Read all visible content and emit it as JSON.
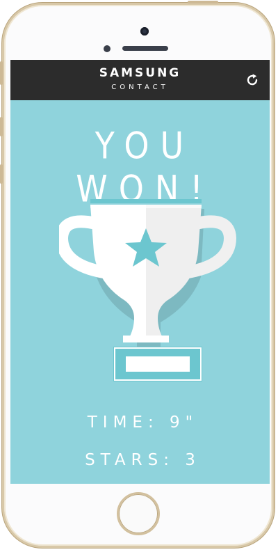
{
  "header": {
    "brand": "SAMSUNG",
    "subtitle": "CONTACT",
    "refresh_icon": "refresh-icon"
  },
  "result": {
    "title": "YOU WON!",
    "trophy_icon": "trophy-icon",
    "time_label": "TIME: 9\"",
    "stars_label": "STARS: 3"
  },
  "device": {
    "home_button": "home-button"
  },
  "colors": {
    "screen_bg": "#8fd3dc",
    "header_bg": "#2c2c2c",
    "accent": "#6cc6cf",
    "text": "#ffffff"
  }
}
